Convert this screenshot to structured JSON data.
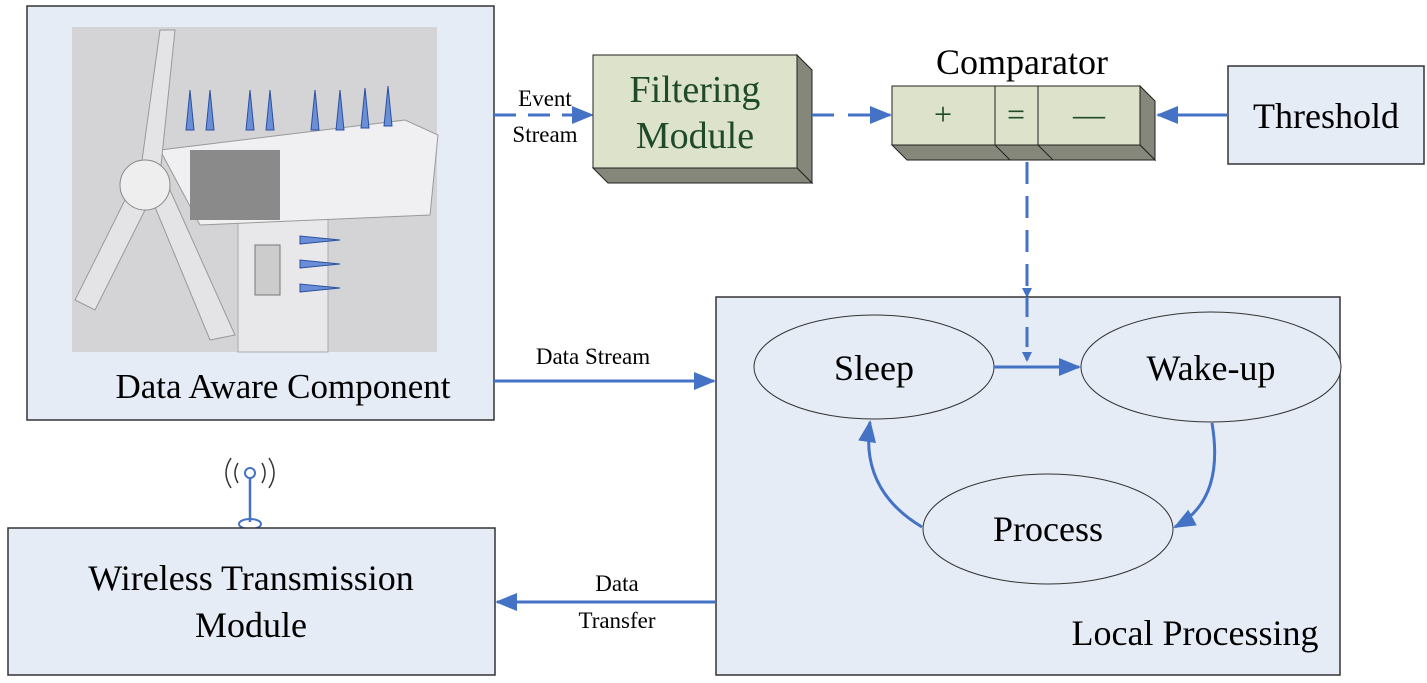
{
  "data_aware": {
    "label": "Data Aware Component"
  },
  "event_stream": {
    "line1": "Event",
    "line2": "Stream"
  },
  "filtering": {
    "line1": "Filtering",
    "line2": "Module"
  },
  "comparator": {
    "title": "Comparator",
    "plus": "+",
    "equals": "=",
    "minus": "—"
  },
  "threshold": {
    "label": "Threshold"
  },
  "data_stream": {
    "label": "Data Stream"
  },
  "states": {
    "sleep": "Sleep",
    "wakeup": "Wake-up",
    "process": "Process"
  },
  "local_processing": {
    "label": "Local Processing"
  },
  "wireless": {
    "line1": "Wireless Transmission",
    "line2": "Module"
  },
  "data_transfer": {
    "line1": "Data",
    "line2": "Transfer"
  },
  "colors": {
    "arrow": "#4472c4",
    "box": "#e6ecf6",
    "module": "#dde2cb",
    "module_side": "#85877a",
    "module_text": "#1f4a2a"
  }
}
